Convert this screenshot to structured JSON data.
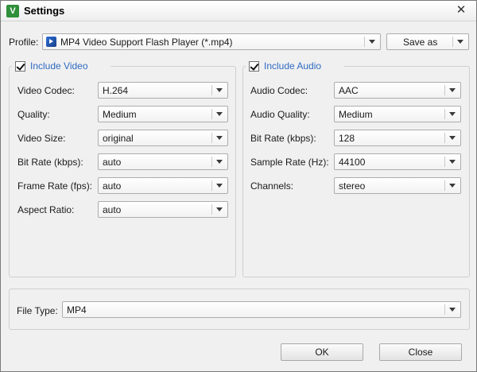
{
  "window": {
    "title": "Settings",
    "app_icon_letter": "V"
  },
  "profile": {
    "label": "Profile:",
    "value": "MP4 Video Support Flash Player (*.mp4)",
    "save_as_label": "Save as"
  },
  "video": {
    "title": "Include Video",
    "checked": true,
    "fields": [
      {
        "label": "Video Codec:",
        "value": "H.264"
      },
      {
        "label": "Quality:",
        "value": "Medium"
      },
      {
        "label": "Video Size:",
        "value": "original"
      },
      {
        "label": "Bit Rate (kbps):",
        "value": "auto"
      },
      {
        "label": "Frame Rate (fps):",
        "value": "auto"
      },
      {
        "label": "Aspect Ratio:",
        "value": "auto"
      }
    ]
  },
  "audio": {
    "title": "Include Audio",
    "checked": true,
    "fields": [
      {
        "label": "Audio Codec:",
        "value": "AAC"
      },
      {
        "label": "Audio Quality:",
        "value": "Medium"
      },
      {
        "label": "Bit Rate (kbps):",
        "value": "128"
      },
      {
        "label": "Sample Rate (Hz):",
        "value": "44100"
      },
      {
        "label": "Channels:",
        "value": "stereo"
      }
    ]
  },
  "file_type": {
    "label": "File Type:",
    "value": "MP4"
  },
  "buttons": {
    "ok": "OK",
    "close": "Close"
  },
  "colors": {
    "group_title": "#2f6bc2",
    "app_icon": "#2f8f3a"
  },
  "icons": {
    "close": "close-icon",
    "profile": "video-profile-icon",
    "dropdown": "chevron-down-icon"
  }
}
